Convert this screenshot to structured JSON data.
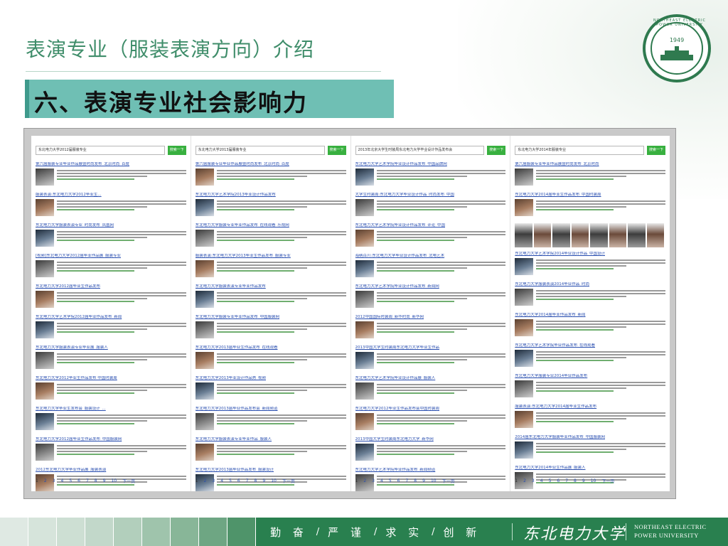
{
  "slide": {
    "title": "表演专业（服装表演方向）介绍",
    "subtitle": "六、表演专业社会影响力"
  },
  "logo": {
    "year": "1949",
    "ring_text": "NORTHEAST ELECTRIC POWER UNIVERSITY"
  },
  "screenshot": {
    "columns": [
      {
        "search_query": "东北电力大学2012届服装专业",
        "search_button": "搜索一下",
        "results": [
          "第六届服装专业毕业作品展暨时尚发布_北京时尚_百度",
          "服装表演:东北电力大学2012毕业生...",
          "东北电力大学服装表演专业_时尚发布_凤凰网",
          "[视频]东北电力大学2012届毕业作品展_服装专业",
          "东北电力大学2012届毕业生作品发布",
          "东北电力大学艺术学院2012届毕业作品发布_新闻",
          "东北电力大学服装表演专业毕业展_服装人",
          "东北电力大学2012毕业生作品发布 中国时装周",
          "东北电力大学毕业生发布会_服装设计_...",
          "东北电力大学2012届毕业生作品发布_中国服装网",
          "2012东北电力大学毕业作品展_服装表演"
        ],
        "pages": [
          "1",
          "2",
          "3",
          "4",
          "5",
          "6",
          "7",
          "8",
          "9",
          "10"
        ],
        "next": "下一页"
      },
      {
        "search_query": "东北电力大学2013届服装专业",
        "search_button": "搜索一下",
        "results": [
          "第六届服装专业毕业作品展暨时尚发布_北京时尚_百度",
          "东北电力大学艺术学院2013毕业设计作品发布",
          "东北电力大学服装专业毕业作品发布_在线观看_乐视网",
          "服装表演:东北电力大学2013毕业生作品发布_服装专业",
          "东北电力大学服装表演专业毕业作品发布",
          "东北电力大学服装专业毕业作品发布_中国服装网",
          "东北电力大学2013届毕业生作品发布_在线观看",
          "东北电力大学2013毕业设计作品秀_视频",
          "东北电力大学2013届毕业作品发布会_新闻频道",
          "东北电力大学服装表演专业毕业作品_服装人",
          "东北电力大学2013届毕业作品发布_服装设计"
        ],
        "pages": [
          "1",
          "2",
          "3",
          "4",
          "5",
          "6",
          "7",
          "8",
          "9",
          "10"
        ],
        "next": "下一页"
      },
      {
        "search_query": "2013年北京大学生时装周东北电力大学毕业设计作品发布会",
        "search_button": "搜索一下",
        "results": [
          "东北电力大学艺术学院毕业设计作品发布_中国品牌网",
          "大学生时装周:东北电力大学毕业设计作品_时尚发布_中国",
          "东北电力大学艺术学院毕业设计作品发布_评论_中国",
          "海纳百川:东北电力大学毕业设计作品发布_北电艺术",
          "东北电力大学艺术学院毕业设计作品发布_新闻网",
          "2012中国国际时装周_新华时尚_新华网",
          "2013中国大学生时装周东北电力大学毕业生作品",
          "东北电力大学艺术学院毕业设计作品展_服装人",
          "东北电力大学2012毕业生作品发布会中国时装周",
          "2013中国大学生时装周东北电力大学_新华网",
          "东北电力大学艺术学院毕业作品发布_新闻频道"
        ],
        "pages": [
          "1",
          "2",
          "3",
          "4",
          "5",
          "6",
          "7",
          "8",
          "9",
          "10"
        ],
        "next": "下一页"
      },
      {
        "search_query": "东北电力大学2014年服装专业",
        "search_button": "搜索一下",
        "results": [
          "第六届服装专业毕业作品展暨时尚发布_北京时尚",
          "东北电力大学2014届毕业生作品发布_中国时装周",
          "东北电力大学艺术学院2014毕业设计作品_中国设计",
          "东北电力大学服装表演2014毕业作品_时尚",
          "东北电力大学2014届毕业作品发布_新闻",
          "东北电力大学艺术学院毕业作品发布_在线观看",
          "东北电力大学服装专业2014毕业作品发布",
          "服装表演:东北电力大学2014届毕业生作品发布",
          "2014届东北电力大学服装毕业作品发布_中国服装网",
          "东北电力大学2014毕业生作品展_服装人",
          "东北电力大学2014届服装表演专业毕业发布"
        ],
        "pages": [
          "1",
          "2",
          "3",
          "4",
          "5",
          "6",
          "7",
          "8",
          "9",
          "10"
        ],
        "next": "下一页"
      }
    ]
  },
  "footer": {
    "motto": [
      "勤 奋",
      "严 谨",
      "求 实",
      "创 新"
    ],
    "separator": "/",
    "university_cn": "东北电力大学",
    "university_en_line1": "NORTHEAST ELECTRIC",
    "university_en_line2": "POWER UNIVERSITY"
  },
  "colors": {
    "title_green": "#3f8d6a",
    "subtitle_bar": "#6fbfb4",
    "footer_green": "#29804f",
    "link_blue": "#2a4fb0",
    "search_button_green": "#38b03f"
  }
}
